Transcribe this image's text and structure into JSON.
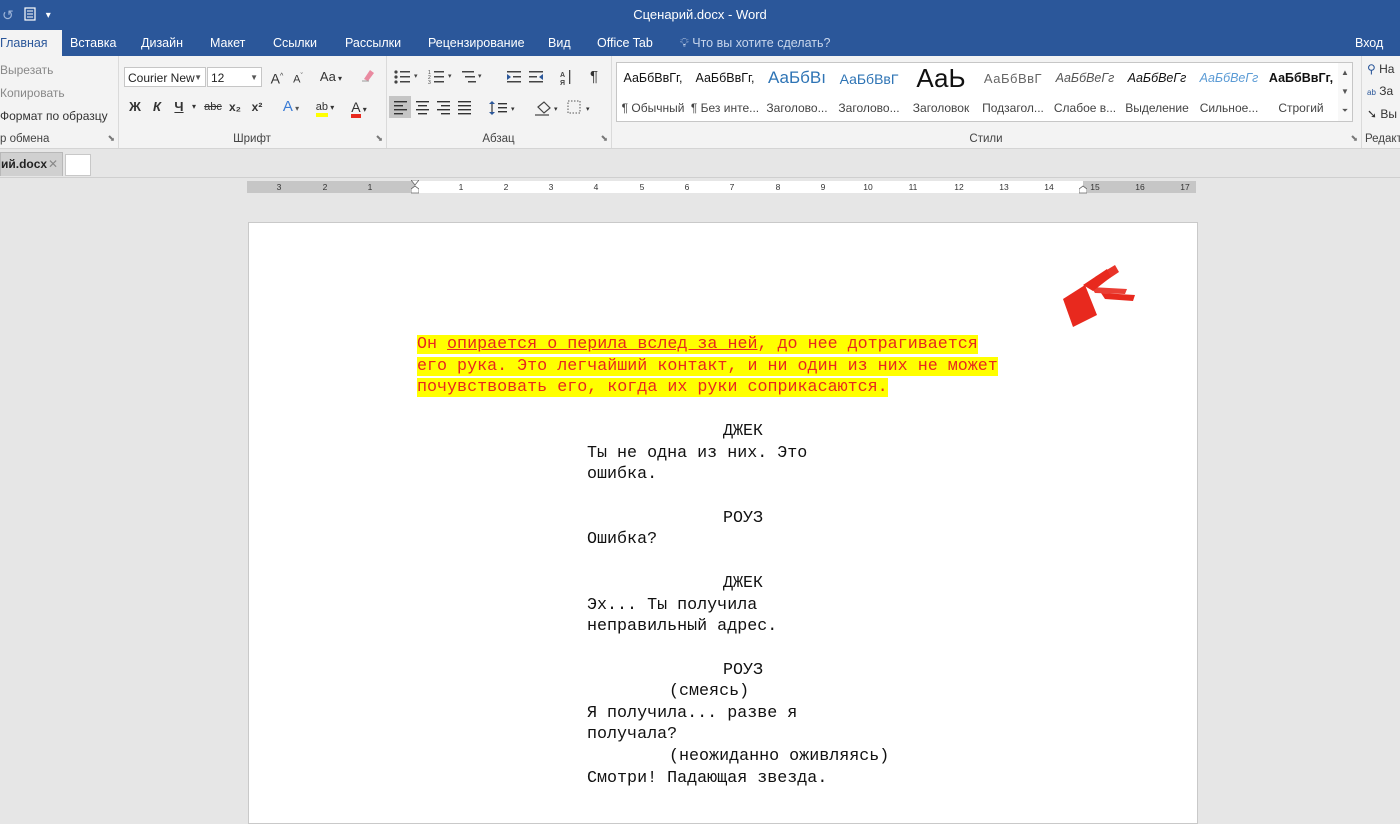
{
  "app": {
    "title": "Сценарий.docx - Word",
    "qat_icons": [
      "redo-icon",
      "document-icon",
      "customize-qat-icon"
    ]
  },
  "tabs": {
    "home": "Главная",
    "insert": "Вставка",
    "design": "Дизайн",
    "layout": "Макет",
    "references": "Ссылки",
    "mailings": "Рассылки",
    "review": "Рецензирование",
    "view": "Вид",
    "officetab": "Office Tab",
    "tell_me": "Что вы хотите сделать?",
    "sign_in": "Вход"
  },
  "ribbon": {
    "clipboard": {
      "cut": "Вырезать",
      "copy": "Копировать",
      "format_painter": "Формат по образцу",
      "label": "р обмена"
    },
    "font": {
      "family": "Courier New",
      "size": "12",
      "grow": "A",
      "shrink": "A",
      "change_case": "Aa",
      "bold": "Ж",
      "italic": "К",
      "underline": "Ч",
      "strike": "abc",
      "subscript": "x₂",
      "superscript": "x²",
      "effects": "A",
      "highlight": "ab",
      "font_color": "A",
      "label": "Шрифт",
      "colors": {
        "highlight": "#ffff00",
        "font_color": "#e8291e"
      }
    },
    "paragraph": {
      "label": "Абзац",
      "pilcrow": "¶"
    },
    "styles": {
      "label": "Стили",
      "items": [
        {
          "preview": "АаБбВвГг,",
          "name": "¶ Обычный"
        },
        {
          "preview": "АаБбВвГг,",
          "name": "¶ Без инте..."
        },
        {
          "preview": "АаБбВı",
          "name": "Заголово..."
        },
        {
          "preview": "АаБбВвГ",
          "name": "Заголово..."
        },
        {
          "preview": "АаЬ",
          "name": "Заголовок"
        },
        {
          "preview": "АаБбВвГ",
          "name": "Подзагол..."
        },
        {
          "preview": "АаБбВеГг",
          "name": "Слабое в..."
        },
        {
          "preview": "АаБбВеГг",
          "name": "Выделение"
        },
        {
          "preview": "АаБбВеГг",
          "name": "Сильное..."
        },
        {
          "preview": "АаБбВвГг,",
          "name": "Строгий"
        }
      ]
    },
    "editing": {
      "find": "На",
      "replace": "За",
      "select": "Вы",
      "label": "Редакт"
    }
  },
  "doc_tab": {
    "name": "ий.docx",
    "close": "✕"
  },
  "ruler": {
    "ticks": [
      "3",
      "2",
      "1",
      "1",
      "2",
      "3",
      "4",
      "5",
      "6",
      "7",
      "8",
      "9",
      "10",
      "11",
      "12",
      "13",
      "14",
      "15",
      "16",
      "17"
    ]
  },
  "document": {
    "action": {
      "l1a": "Он ",
      "l1b": "опирается о перила вслед за ней",
      "l1c": ", до нее дотрагивается",
      "l2": "его рука. Это легчайший контакт, и ни один из них не может",
      "l3": "почувствовать его, когда их руки соприкасаются."
    },
    "cue1": "ДЖЕК",
    "dial1a": "Ты не одна из них. Это",
    "dial1b": "ошибка.",
    "cue2": "РОУЗ",
    "dial2": "Ошибка?",
    "cue3": "ДЖЕК",
    "dial3a": "Эх... Ты получила",
    "dial3b": "неправильный адрес.",
    "cue4": "РОУЗ",
    "paren4": "(смеясь)",
    "dial4a": "Я получила... разве я",
    "dial4b": "получала?",
    "paren4b": "(неожиданно оживляясь)",
    "dial4c": "Смотри! Падающая звезда."
  },
  "colors": {
    "titlebar": "#2b579a",
    "action_text": "#e8291e",
    "highlight": "#ffff00",
    "logo": "#e8291e"
  }
}
